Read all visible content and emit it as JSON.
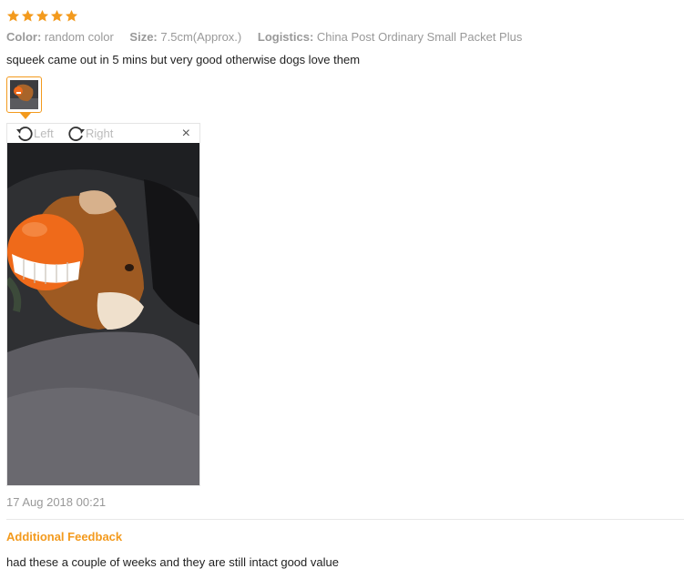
{
  "review": {
    "rating": 5,
    "star_color": "#f39a1d",
    "attributes": [
      {
        "key": "Color:",
        "value": "random color"
      },
      {
        "key": "Size:",
        "value": "7.5cm(Approx.)"
      },
      {
        "key": "Logistics:",
        "value": "China Post Ordinary Small Packet Plus"
      }
    ],
    "comment": "squeek came out in 5 mins but very good otherwise dogs love them",
    "viewer": {
      "rotate_left_label": "Left",
      "rotate_right_label": "Right",
      "close_label": "×"
    },
    "date": "17 Aug 2018 00:21",
    "additional_feedback": {
      "title": "Additional Feedback",
      "text": "had these a couple of weeks and they are still intact good value"
    }
  }
}
